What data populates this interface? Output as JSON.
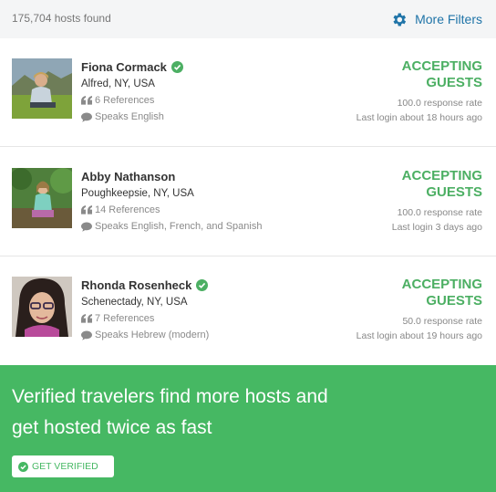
{
  "results": {
    "count_label": "175,704 hosts found",
    "more_filters_label": "More Filters"
  },
  "hosts": [
    {
      "name": "Fiona Cormack",
      "location": "Alfred, NY, USA",
      "references": "6 References",
      "languages": "Speaks English",
      "status_line1": "ACCEPTING",
      "status_line2": "GUESTS",
      "response_rate": "100.0 response rate",
      "last_login": "Last login about 18 hours ago"
    },
    {
      "name": "Abby Nathanson",
      "location": "Poughkeepsie, NY, USA",
      "references": "14 References",
      "languages": "Speaks English, French, and Spanish",
      "status_line1": "ACCEPTING",
      "status_line2": "GUESTS",
      "response_rate": "100.0 response rate",
      "last_login": "Last login 3 days ago"
    },
    {
      "name": "Rhonda Rosenheck",
      "location": "Schenectady, NY, USA",
      "references": "7 References",
      "languages": "Speaks Hebrew (modern)",
      "status_line1": "ACCEPTING",
      "status_line2": "GUESTS",
      "response_rate": "50.0 response rate",
      "last_login": "Last login about 19 hours ago"
    }
  ],
  "promo": {
    "line1": "Verified travelers find more hosts and",
    "line2": "get hosted twice as fast",
    "button_label": "GET VERIFIED"
  },
  "colors": {
    "accent_green": "#46b863",
    "status_green": "#4caf63",
    "link_blue": "#1f74a8"
  }
}
